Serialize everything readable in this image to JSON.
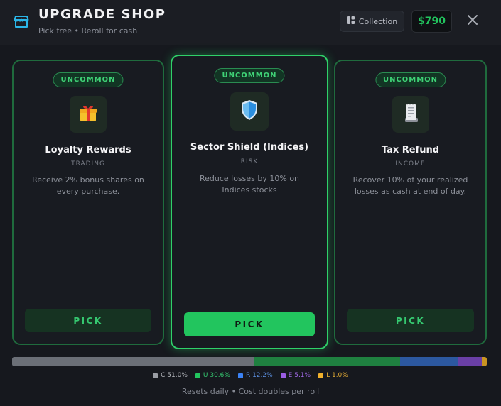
{
  "header": {
    "title": "UPGRADE SHOP",
    "subtitle": "Pick free • Reroll for cash",
    "collection_label": "Collection",
    "cash": "$790",
    "icons": {
      "shop": "storefront-icon",
      "collection": "grid-icon",
      "close": "close-icon"
    }
  },
  "cards": [
    {
      "rarity": "UNCOMMON",
      "icon": "gift-icon",
      "name": "Loyalty Rewards",
      "category": "TRADING",
      "description": "Receive 2% bonus shares on every purchase.",
      "pick_label": "PICK",
      "selected": false
    },
    {
      "rarity": "UNCOMMON",
      "icon": "shield-icon",
      "name": "Sector Shield (Indices)",
      "category": "RISK",
      "description": "Reduce losses by 10% on Indices stocks",
      "pick_label": "PICK",
      "selected": true
    },
    {
      "rarity": "UNCOMMON",
      "icon": "receipt-icon",
      "name": "Tax Refund",
      "category": "INCOME",
      "description": "Recover 10% of your realized losses as cash at end of day.",
      "pick_label": "PICK",
      "selected": false
    }
  ],
  "rarity_odds": [
    {
      "label": "C 51.0%",
      "percent": 51.0,
      "color": "#6b6f77",
      "text_color": "#b5b8be"
    },
    {
      "label": "U 30.6%",
      "percent": 30.6,
      "color": "#1f8040",
      "text_color": "#35c870"
    },
    {
      "label": "R 12.2%",
      "percent": 12.2,
      "color": "#2c58a0",
      "text_color": "#5b8fe0"
    },
    {
      "label": "E 5.1%",
      "percent": 5.1,
      "color": "#6a3fa6",
      "text_color": "#a069e6"
    },
    {
      "label": "L 1.0%",
      "percent": 1.0,
      "color": "#c99422",
      "text_color": "#e0a934"
    }
  ],
  "footer": "Resets daily • Cost doubles per roll",
  "colors": {
    "accent": "#22c55e",
    "background": "#16181e"
  }
}
